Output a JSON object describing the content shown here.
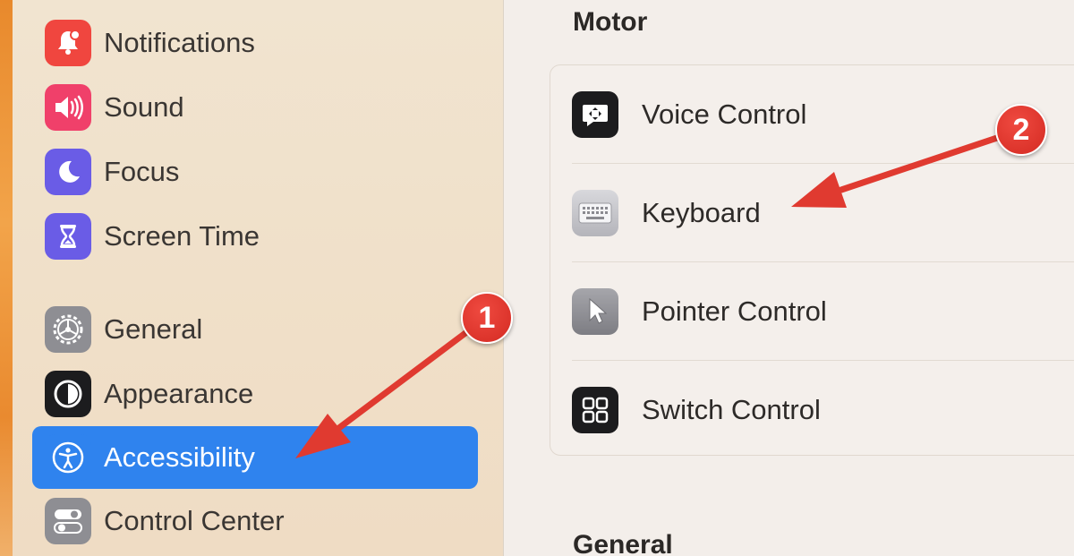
{
  "sidebar": {
    "items": [
      {
        "label": "Notifications",
        "icon": "bell-icon",
        "color": "#f0463f"
      },
      {
        "label": "Sound",
        "icon": "speaker-icon",
        "color": "#f0406a"
      },
      {
        "label": "Focus",
        "icon": "moon-icon",
        "color": "#6a5ce6"
      },
      {
        "label": "Screen Time",
        "icon": "hourglass-icon",
        "color": "#6a5ce6"
      },
      {
        "label": "General",
        "icon": "gear-icon",
        "color": "#8e8e93"
      },
      {
        "label": "Appearance",
        "icon": "appearance-icon",
        "color": "#1c1c1e"
      },
      {
        "label": "Accessibility",
        "icon": "accessibility-icon",
        "color": "#2f83ee",
        "selected": true
      },
      {
        "label": "Control Center",
        "icon": "toggles-icon",
        "color": "#8e8e93"
      }
    ]
  },
  "main": {
    "sections": [
      {
        "title": "Motor"
      },
      {
        "title": "General"
      }
    ],
    "motor_rows": [
      {
        "label": "Voice Control",
        "icon": "voice-control-icon"
      },
      {
        "label": "Keyboard",
        "icon": "keyboard-icon"
      },
      {
        "label": "Pointer Control",
        "icon": "pointer-icon"
      },
      {
        "label": "Switch Control",
        "icon": "switch-control-icon"
      }
    ]
  },
  "annotations": {
    "badges": [
      {
        "number": "1"
      },
      {
        "number": "2"
      }
    ],
    "color": "#e03a30"
  }
}
